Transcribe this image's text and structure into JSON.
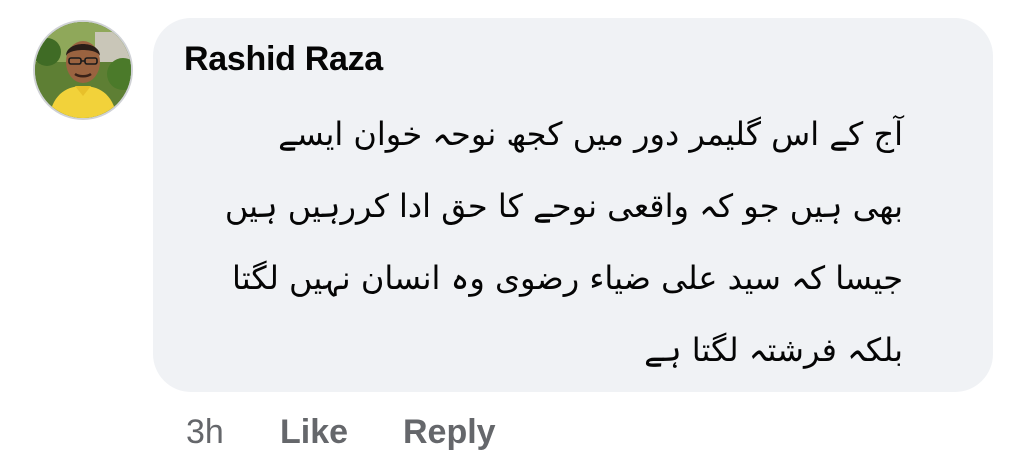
{
  "comment": {
    "author": "Rashid Raza",
    "lines": [
      "آج کے اس گلیمر دور میں کجھ نوحہ خوان ایسے",
      "بھی ہیں جو کہ واقعی نوحے کا حق ادا کررہیں  ہیں",
      "جیسا کہ سید علی  ضیاء رضوی وہ انسان نہیں لگتا",
      "بلکہ فرشتہ لگتا ہے"
    ],
    "timestamp": "3h",
    "like_label": "Like",
    "reply_label": "Reply"
  },
  "colors": {
    "bubble_bg": "#f0f2f5",
    "author_text": "#050505",
    "body_text": "#050505",
    "action_text": "#65676b"
  }
}
